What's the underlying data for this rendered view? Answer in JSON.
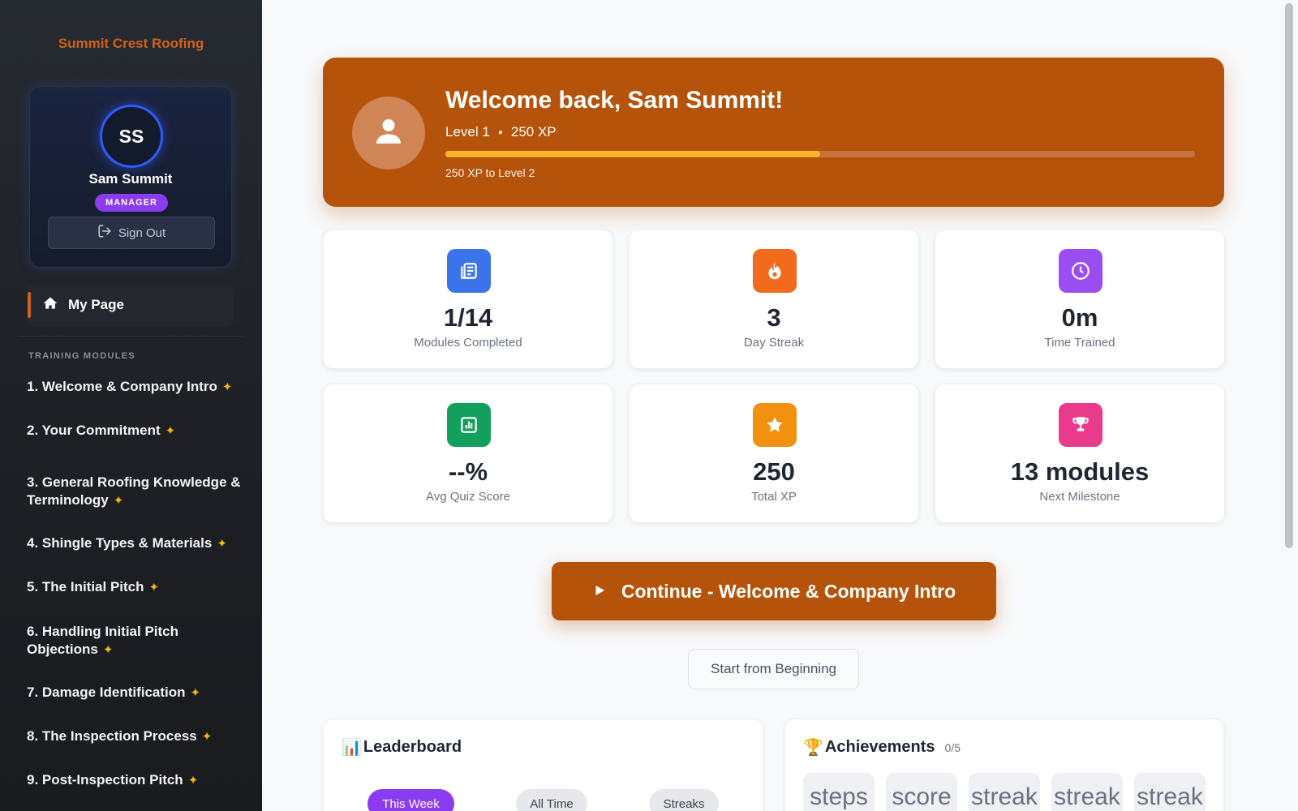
{
  "sidebar": {
    "brand": "Summit Crest Roofing",
    "profile": {
      "initials": "SS",
      "name": "Sam Summit",
      "role": "MANAGER",
      "sign_out_label": "Sign Out"
    },
    "my_page_label": "My Page",
    "section_label": "TRAINING MODULES",
    "modules": [
      {
        "line1": "1. Welcome & Company Intro",
        "line2": ""
      },
      {
        "line1": "2. Your Commitment",
        "line2": ""
      },
      {
        "line1": "3. General Roofing Knowledge &",
        "line2": "Terminology"
      },
      {
        "line1": "4. Shingle Types & Materials",
        "line2": ""
      },
      {
        "line1": "5. The Initial Pitch",
        "line2": ""
      },
      {
        "line1": "6. Handling Initial Pitch",
        "line2": "Objections"
      },
      {
        "line1": "7. Damage Identification",
        "line2": ""
      },
      {
        "line1": "8. The Inspection Process",
        "line2": ""
      },
      {
        "line1": "9. Post-Inspection Pitch",
        "line2": ""
      }
    ],
    "spark_glyph": "✦"
  },
  "hero": {
    "title": "Welcome back, Sam Summit!",
    "level": "Level 1",
    "xp": "250 XP",
    "xp_progress_fraction": 0.5,
    "next_level_text": "250 XP to Level 2"
  },
  "stats": [
    {
      "value": "1/14",
      "label": "Modules Completed",
      "icon": "document-icon",
      "color": "#3b73ea"
    },
    {
      "value": "3",
      "label": "Day Streak",
      "icon": "flame-icon",
      "color": "#f26a1b"
    },
    {
      "value": "0m",
      "label": "Time Trained",
      "icon": "clock-icon",
      "color": "#9b4df2"
    },
    {
      "value": "--%",
      "label": "Avg Quiz Score",
      "icon": "bar-chart-icon",
      "color": "#12a05c"
    },
    {
      "value": "250",
      "label": "Total XP",
      "icon": "star-icon",
      "color": "#f2910f"
    },
    {
      "value": "13 modules",
      "label": "Next Milestone",
      "icon": "trophy-icon",
      "color": "#ea3a8c"
    }
  ],
  "actions": {
    "continue_label": "Continue - Welcome & Company Intro",
    "restart_label": "Start from Beginning"
  },
  "leaderboard": {
    "emoji": "📊",
    "title": "Leaderboard",
    "tabs": [
      "This Week",
      "All Time",
      "Streaks"
    ],
    "active_tab": "This Week"
  },
  "achievements": {
    "emoji": "🏆",
    "title": "Achievements",
    "count": "0/5",
    "items": [
      "steps",
      "score",
      "streak",
      "streak",
      "streak"
    ]
  }
}
